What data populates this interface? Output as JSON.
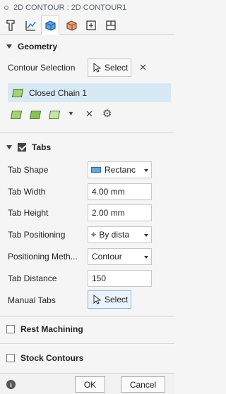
{
  "title": "2D CONTOUR : 2D CONTOUR1",
  "tabs": [
    "tool",
    "geometry",
    "heights",
    "passes",
    "linking",
    "multi-axis"
  ],
  "geometry": {
    "header": "Geometry",
    "contour_selection_label": "Contour Selection",
    "select_label": "Select",
    "chain_label": "Closed Chain 1"
  },
  "tabs_section": {
    "header": "Tabs",
    "tab_shape_label": "Tab Shape",
    "tab_shape_value": "Rectanc",
    "tab_width_label": "Tab Width",
    "tab_width_value": "4.00 mm",
    "tab_height_label": "Tab Height",
    "tab_height_value": "2.00 mm",
    "tab_positioning_label": "Tab Positioning",
    "tab_positioning_value": "By dista",
    "positioning_method_label": "Positioning Meth...",
    "positioning_method_value": "Contour",
    "tab_distance_label": "Tab Distance",
    "tab_distance_value": "150",
    "manual_tabs_label": "Manual Tabs",
    "manual_select_label": "Select"
  },
  "rest_machining_label": "Rest Machining",
  "stock_contours_label": "Stock Contours",
  "footer": {
    "ok_label": "OK",
    "cancel_label": "Cancel"
  }
}
